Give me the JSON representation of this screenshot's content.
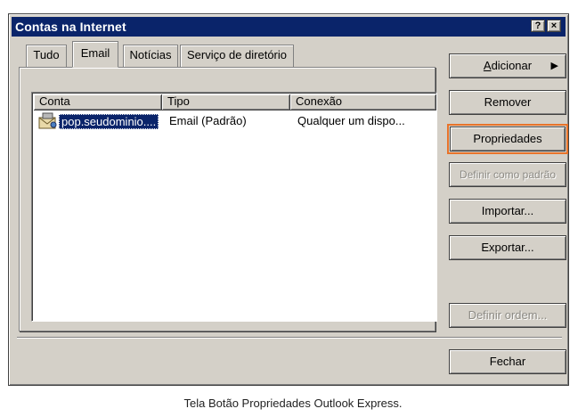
{
  "window": {
    "title": "Contas na Internet"
  },
  "caption_buttons": {
    "help": "?",
    "close": "×"
  },
  "tabs": [
    {
      "label": "Tudo"
    },
    {
      "label": "Email"
    },
    {
      "label": "Notícias"
    },
    {
      "label": "Serviço de diretório"
    }
  ],
  "active_tab": "Email",
  "list": {
    "columns": [
      "Conta",
      "Tipo",
      "Conexão"
    ],
    "rows": [
      {
        "conta": "pop.seudominio....",
        "tipo": "Email (Padrão)",
        "conexao": "Qualquer um dispo..."
      }
    ]
  },
  "buttons": {
    "adicionar_prefix": "A",
    "adicionar_rest": "dicionar",
    "adicionar_arrow": "▶",
    "remover": "Remover",
    "propriedades": "Propriedades",
    "definir_padrao": "Definir como padrão",
    "importar": "Importar...",
    "exportar": "Exportar...",
    "definir_ordem": "Definir ordem...",
    "fechar": "Fechar"
  },
  "caption": "Tela Botão Propriedades Outlook Express.",
  "colors": {
    "titlebar": "#0a246a",
    "face": "#d4d0c8",
    "highlight": "#e8732a"
  }
}
